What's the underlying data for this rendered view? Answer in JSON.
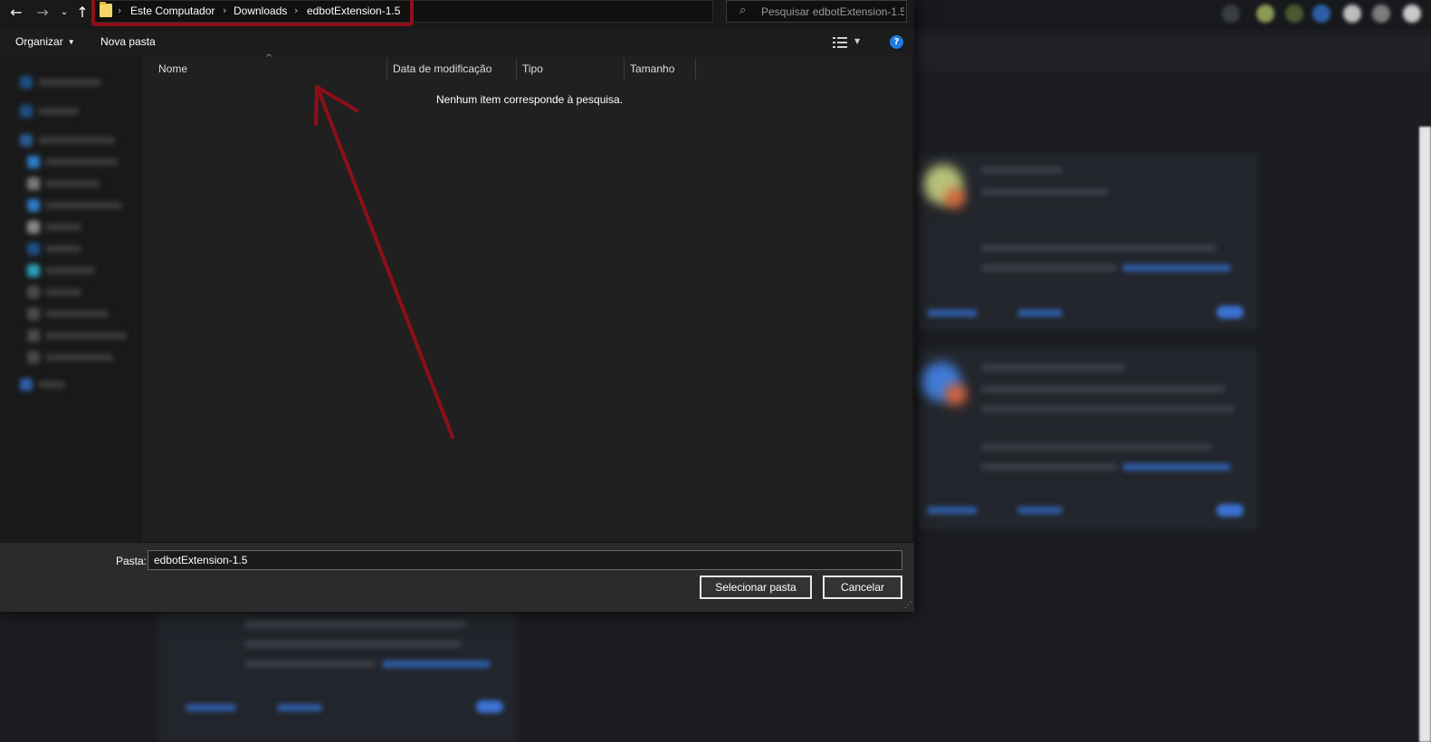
{
  "addressbar": {
    "crumbs": [
      "Este Computador",
      "Downloads",
      "edbotExtension-1.5"
    ],
    "search_placeholder": "Pesquisar edbotExtension-1.5"
  },
  "toolbar": {
    "organize_label": "Organizar",
    "new_folder_label": "Nova pasta"
  },
  "file_list": {
    "columns": [
      "Nome",
      "Data de modificação",
      "Tipo",
      "Tamanho"
    ],
    "empty_message": "Nenhum item corresponde à pesquisa."
  },
  "bottom": {
    "folder_label": "Pasta:",
    "folder_value": "edbotExtension-1.5",
    "select_button": "Selecionar pasta",
    "cancel_button": "Cancelar"
  },
  "annotation": {
    "highlight_color": "#8e0f18"
  },
  "icons": {
    "back": "back-arrow-icon",
    "forward": "forward-arrow-icon",
    "recent": "recent-locations-chevron-icon",
    "up": "up-arrow-icon",
    "folder": "folder-icon",
    "refresh": "refresh-icon",
    "search": "search-icon",
    "view": "view-options-icon",
    "help": "help-icon"
  }
}
